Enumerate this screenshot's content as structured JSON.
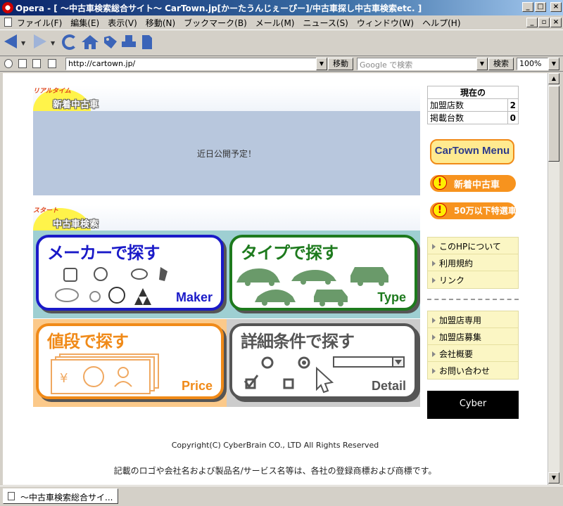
{
  "window": {
    "title": "Opera - [ ～中古車検索総合サイト～ CarTown.jp[かーたうんじぇーぴー]/中古車探し中古車検索etc. ]",
    "icon": "opera-icon",
    "buttons": {
      "minimize": "_",
      "maximize": "□",
      "close": "×",
      "restore": "▫"
    }
  },
  "menu": [
    "ファイル(F)",
    "編集(E)",
    "表示(V)",
    "移動(N)",
    "ブックマーク(B)",
    "メール(M)",
    "ニュース(S)",
    "ウィンドウ(W)",
    "ヘルプ(H)"
  ],
  "toolbar": {
    "icons": [
      "back-icon",
      "forward-icon",
      "reload-icon",
      "home-icon",
      "hotlist-icon",
      "print-icon",
      "page-icon"
    ]
  },
  "address": {
    "url": "http://cartown.jp/",
    "go_label": "移動",
    "search_placeholder": "Google で検索",
    "search_label": "検索",
    "zoom": "100%"
  },
  "page": {
    "newcars": {
      "small": "リアルタイム",
      "title": "新着中古車",
      "message": "近日公開予定！"
    },
    "search": {
      "small": "スタート",
      "title": "中古車検索",
      "cards": [
        {
          "title": "メーカーで探す",
          "sub": "Maker",
          "color": "#1a1ac8",
          "bg": "#9ecfd2"
        },
        {
          "title": "タイプで探す",
          "sub": "Type",
          "color": "#1d7a1d",
          "bg": "#9ecfd2"
        },
        {
          "title": "値段で探す",
          "sub": "Price",
          "color": "#f08a18",
          "bg": "#fbc98a"
        },
        {
          "title": "詳細条件で探す",
          "sub": "Detail",
          "color": "#555555",
          "bg": "#cccccc"
        }
      ]
    },
    "stats": {
      "head": "現在の",
      "rows": [
        {
          "label": "加盟店数",
          "value": "2"
        },
        {
          "label": "掲載台数",
          "value": "0"
        }
      ]
    },
    "sidebar": {
      "menu_button": "CarTown Menu",
      "pills": [
        "新着中古車",
        "50万以下特選車"
      ],
      "links1": [
        "このHPについて",
        "利用規約",
        "リンク"
      ],
      "links2": [
        "加盟店専用",
        "加盟店募集",
        "会社概要",
        "お問い合わせ"
      ],
      "banner": "Cyber"
    },
    "footer": {
      "copyright": "Copyright(C) CyberBrain CO., LTD All Rights Reserved",
      "note": "記載のロゴや会社名および製品名/サービス名等は、各社の登録商標および商標です。"
    }
  },
  "status": {
    "tab": "～中古車検索総合サイ..."
  }
}
